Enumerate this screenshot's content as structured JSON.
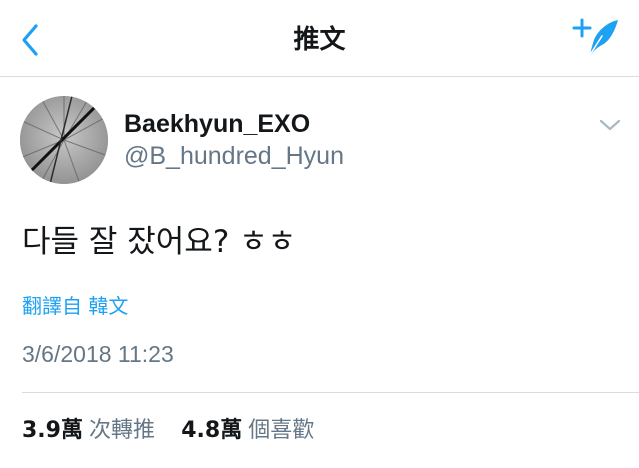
{
  "nav": {
    "title": "推文",
    "back_icon": "chevron-left-icon",
    "compose_icon": "compose-feather-icon",
    "accent_color": "#1da1f2"
  },
  "tweet": {
    "author": {
      "name": "Baekhyun_EXO",
      "handle": "@B_hundred_Hyun",
      "avatar": "avatar-image"
    },
    "menu_icon": "chevron-down-icon",
    "text": "다들 잘 잤어요? ㅎㅎ",
    "translate_label": "翻譯自 韓文",
    "timestamp": "3/6/2018 11:23",
    "stats": {
      "retweets_count": "3.9萬",
      "retweets_label": "次轉推",
      "likes_count": "4.8萬",
      "likes_label": "個喜歡"
    }
  },
  "colors": {
    "text_primary": "#14171a",
    "text_secondary": "#657786",
    "link": "#1da1f2",
    "divider": "#d8dde2"
  }
}
